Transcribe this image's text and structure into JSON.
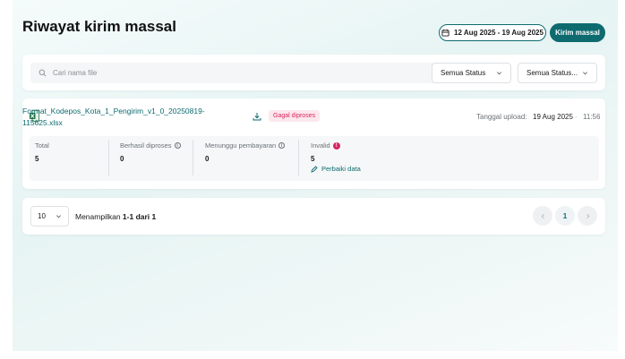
{
  "header": {
    "title": "Riwayat kirim massal",
    "date_range": "12 Aug 2025 - 19 Aug 2025",
    "send_button": "Kirim massal"
  },
  "filters": {
    "search_placeholder": "Cari nama file",
    "status_select": "Semua Status",
    "status_select_2": "Semua Status..."
  },
  "file": {
    "name": "Format_Kodepos_Kota_1_Pengirim_v1_0_20250819-115625.xlsx",
    "status": "Gagal diproses",
    "upload_label": "Tanggal upload:",
    "upload_date": "19 Aug 2025",
    "upload_separator": "·",
    "upload_time": "11:56",
    "stats": {
      "total_label": "Total",
      "total_value": "5",
      "success_label": "Berhasil diproses",
      "success_value": "0",
      "pending_label": "Menunggu pembayaran",
      "pending_value": "0",
      "invalid_label": "Invalid",
      "invalid_value": "5",
      "fix_link": "Perbaiki data"
    }
  },
  "pagination": {
    "per_page": "10",
    "showing_prefix": "Menampilkan ",
    "showing_range": "1-1 dari 1",
    "current_page": "1"
  },
  "colors": {
    "primary": "#0d6b70",
    "error": "#d72660",
    "error_bg": "#fde8ee"
  }
}
